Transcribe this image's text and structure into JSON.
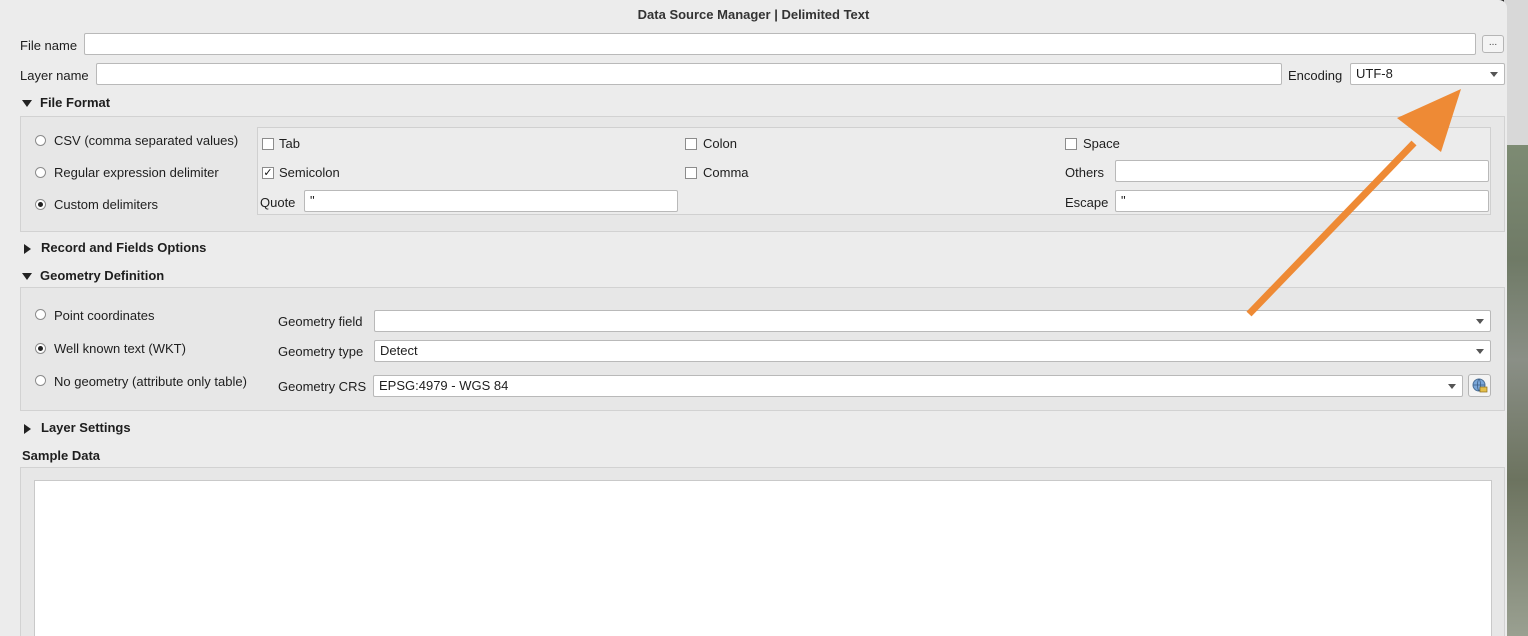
{
  "window": {
    "title": "Data Source Manager | Delimited Text"
  },
  "file": {
    "label": "File name",
    "value": "",
    "browse_label": "..."
  },
  "layer": {
    "label": "Layer name",
    "value": ""
  },
  "encoding": {
    "label": "Encoding",
    "value": "UTF-8"
  },
  "file_format": {
    "title": "File Format",
    "options": [
      {
        "label": "CSV (comma separated values)",
        "checked": false
      },
      {
        "label": "Regular expression delimiter",
        "checked": false
      },
      {
        "label": "Custom delimiters",
        "checked": true
      }
    ],
    "delimiters": {
      "tab": {
        "label": "Tab",
        "checked": false
      },
      "colon": {
        "label": "Colon",
        "checked": false
      },
      "space": {
        "label": "Space",
        "checked": false
      },
      "semicolon": {
        "label": "Semicolon",
        "checked": true,
        "mark": "✓"
      },
      "comma": {
        "label": "Comma",
        "checked": false
      }
    },
    "others_label": "Others",
    "others_value": "",
    "quote_label": "Quote",
    "quote_value": "\"",
    "escape_label": "Escape",
    "escape_value": "\""
  },
  "record_options": {
    "title": "Record and Fields Options"
  },
  "geometry": {
    "title": "Geometry Definition",
    "options": [
      {
        "label": "Point coordinates",
        "checked": false
      },
      {
        "label": "Well known text (WKT)",
        "checked": true
      },
      {
        "label": "No geometry (attribute only table)",
        "checked": false
      }
    ],
    "field_label": "Geometry field",
    "field_value": "",
    "type_label": "Geometry type",
    "type_value": "Detect",
    "crs_label": "Geometry CRS",
    "crs_value": "EPSG:4979 - WGS 84"
  },
  "layer_settings": {
    "title": "Layer Settings"
  },
  "sample": {
    "title": "Sample Data"
  },
  "colors": {
    "annotation_arrow": "#ee8a35",
    "window_bg": "#ececec"
  },
  "icons": {
    "crs_select": "globe-crs-icon",
    "annotation": "arrow-icon"
  }
}
